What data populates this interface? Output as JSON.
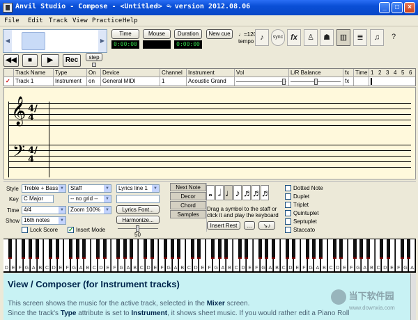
{
  "window": {
    "title": "Anvil Studio - Compose - <Untitled> - version 2012.08.06",
    "nav_arrows": "⇦ ↶ ↷"
  },
  "menu": [
    "File",
    "Edit",
    "Track",
    "View",
    "Practice",
    "Help"
  ],
  "toolbar": {
    "time_label": "Time",
    "mouse_label": "Mouse",
    "duration_label": "Duration",
    "new_cue_label": "New cue",
    "time_value": "0:00:00",
    "mouse_value": "",
    "duration_value": "0:00:00",
    "tempo_value": "♩=120",
    "tempo_label": "tempo",
    "sync_label": "sync",
    "fx_label": "fx",
    "rec_label": "Rec",
    "step_label": "step"
  },
  "track_grid": {
    "headers": [
      "Track Name",
      "Type",
      "On",
      "Device",
      "Channel",
      "Instrument",
      "Vol",
      "L/R Balance",
      "fx",
      "Time",
      "1",
      "2",
      "3",
      "4",
      "5",
      "6"
    ],
    "row": {
      "name": "Track 1",
      "type": "Instrument",
      "on": "on",
      "device": "General MIDI",
      "channel": "1",
      "instrument": "Acoustic Grand",
      "fx": "fx"
    }
  },
  "staff": {
    "treble_time": "4/4",
    "bass_time": "4/4",
    "treble_clef": "𝄞",
    "bass_clef": "𝄢"
  },
  "controls": {
    "style_label": "Style",
    "style_value": "Treble + Bass",
    "key_label": "Key",
    "key_value": "C Major",
    "time_label": "Time",
    "time_value": "4/4",
    "show_label": "Show",
    "show_value": "16th notes",
    "lock_score": "Lock Score",
    "insert_mode": "Insert Mode",
    "view_value": "Staff",
    "grid_value": "-- no grid --",
    "zoom_value": "Zoom 100%",
    "lyrics_value": "Lyrics line 1",
    "lyrics_font": "Lyrics Font...",
    "harmonize": "Harmonize...",
    "harmonize_value": "50",
    "tabs": [
      "Next Note",
      "Decor",
      "Chord",
      "Samples"
    ],
    "drag_hint_1": "Drag a symbol to the staff or",
    "drag_hint_2": "click it and play the keyboard",
    "insert_rest": "Insert Rest",
    "ellipsis": "...",
    "modifiers": [
      "Dotted Note",
      "Duplet",
      "Triplet",
      "Quintuplet",
      "Septuplet",
      "Staccato"
    ]
  },
  "keyboard": {
    "white_keys": [
      "D",
      "E",
      "F",
      "G",
      "A",
      "B",
      "C",
      "D",
      "E",
      "F",
      "G",
      "A",
      "B",
      "C",
      "D",
      "E",
      "F",
      "G",
      "A",
      "B",
      "C",
      "D",
      "E",
      "F",
      "G",
      "A",
      "B",
      "C",
      "D",
      "E",
      "F",
      "G",
      "A",
      "B",
      "C",
      "D",
      "E",
      "F",
      "G",
      "A",
      "B",
      "C",
      "D",
      "E",
      "F",
      "G",
      "A",
      "B",
      "C",
      "D",
      "E",
      "F",
      "G",
      "A",
      "B",
      "C",
      "D",
      "E",
      "F",
      "G",
      "A"
    ]
  },
  "help": {
    "title": "View / Composer (for Instrument tracks)",
    "line1_a": "This screen shows the music for the active track, selected in the ",
    "line1_b": "Mixer",
    "line1_c": " screen.",
    "line2_a": "Since the track's ",
    "line2_b": "Type",
    "line2_c": " attribute is set to ",
    "line2_d": "Instrument",
    "line2_e": ", it shows sheet music. If you would rather edit a Piano Roll",
    "watermark": "当下软件园",
    "watermark_url": "www.downxia.com"
  }
}
